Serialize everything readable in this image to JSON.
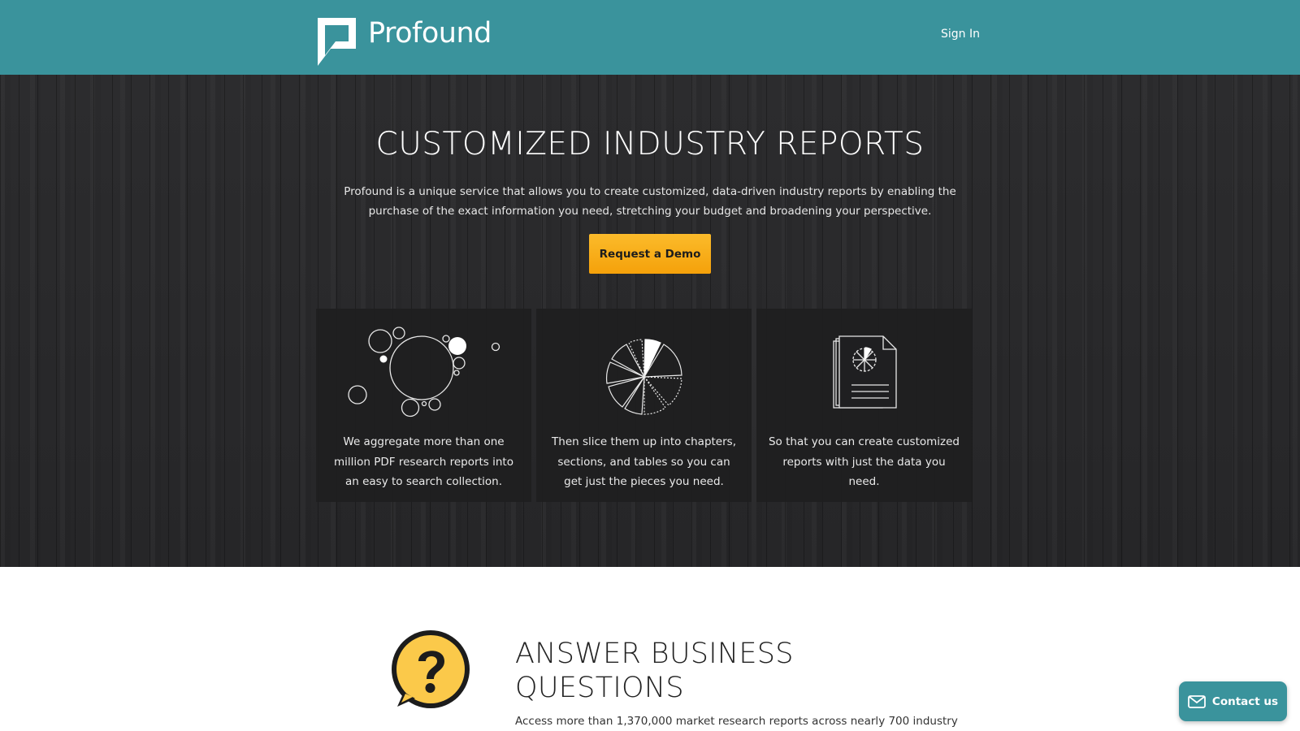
{
  "header": {
    "brand_name": "Profound",
    "signin_label": "Sign In"
  },
  "hero": {
    "title": "CUSTOMIZED INDUSTRY REPORTS",
    "description": "Profound is a unique service that allows you to create customized, data-driven industry reports by enabling the purchase of the exact information you need, stretching your budget and broadening your perspective.",
    "cta_label": "Request a Demo",
    "cards": [
      {
        "icon": "bubbles-icon",
        "text": "We aggregate more than one million PDF research reports into an easy to search collection."
      },
      {
        "icon": "sliced-pie-icon",
        "text": "Then slice them up into chapters, sections, and tables so you can get just the pieces you need."
      },
      {
        "icon": "report-document-icon",
        "text": "So that you can create customized reports with just the data you need."
      }
    ]
  },
  "answer": {
    "icon": "question-bubble-icon",
    "title_line1": "ANSWER BUSINESS",
    "title_line2": "QUESTIONS",
    "text": "Access more than 1,370,000 market research reports across nearly 700 industry"
  },
  "contact": {
    "label": "Contact us",
    "icon": "mail-icon"
  },
  "colors": {
    "header_bg": "#3a939c",
    "cta_bg": "#f9b21d",
    "hero_bg": "#2a2a2c",
    "question_icon_yellow": "#fbc94a"
  }
}
